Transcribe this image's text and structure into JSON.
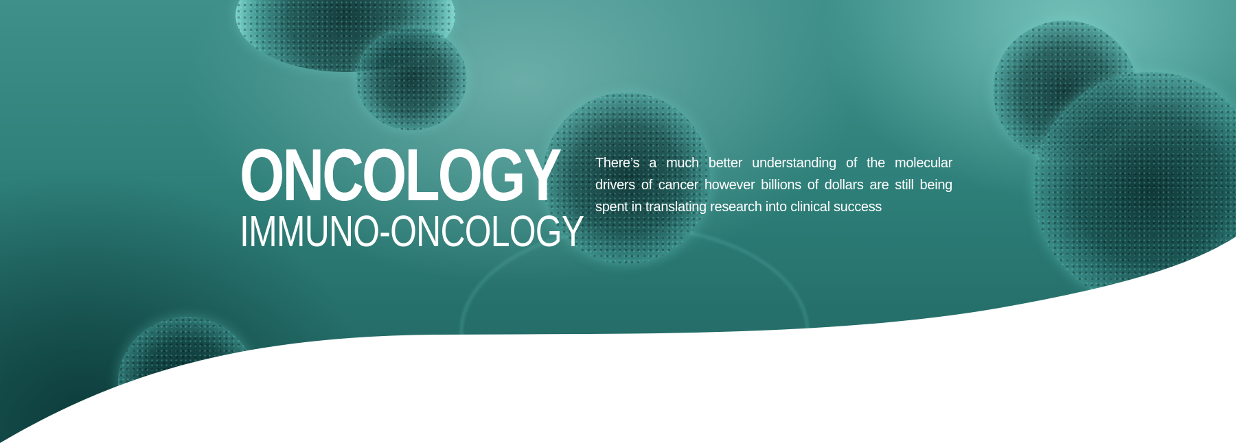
{
  "hero": {
    "title": "ONCOLOGY",
    "subtitle": "IMMUNO-ONCOLOGY",
    "description": "There’s a much better understanding of the molecular drivers of cancer however billions of dollars are still being spent in translating research into clinical success"
  },
  "colors": {
    "background_teal": "#2f807a",
    "wave_fill": "#ffffff",
    "text": "#ffffff"
  }
}
